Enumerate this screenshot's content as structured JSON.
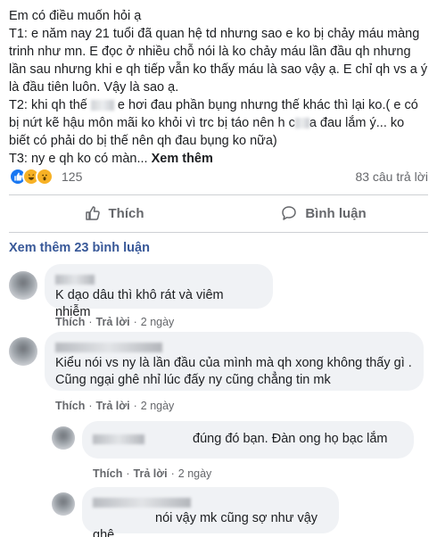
{
  "post": {
    "line1": "Em có điều muốn hỏi ạ",
    "t1": "T1: e năm nay 21 tuổi đã quan hệ td nhưng sao e ko bị chảy máu màng trinh như mn. E đọc ở nhiều chỗ nói là ko chảy máu lần đầu qh nhưng lần sau nhưng khi e qh tiếp vẫn ko thấy máu là sao vậy ạ. E chỉ qh vs a ý là đầu tiên luôn. Vậy là sao ạ.",
    "t2_a": "T2: khi qh thế",
    "t2_b": "e hơi đau phần bụng nhưng thế khác thì lại ko.( e có bị nứt kẽ hậu môn mãi ko khỏi vì trc bị táo nên h c",
    "t2_c": "a đau lắm ý... ko biết có phải do bị thế nên qh đau bụng ko nữa)",
    "t3": "T3: ny e qh ko có màn...",
    "see_more": "Xem thêm"
  },
  "reactions": {
    "count": "125",
    "answers": "83 câu trả lời"
  },
  "actions": {
    "like": "Thích",
    "comment": "Bình luận"
  },
  "view_more_comments": "Xem thêm 23 bình luận",
  "comments": [
    {
      "text": "K dạo dâu thì khô rát và viêm nhiễm",
      "like": "Thích",
      "reply": "Trả lời",
      "time": "2 ngày"
    },
    {
      "text": "Kiểu nói vs ny là lần đầu của mình mà qh xong không thấy gì . Cũng ngại ghê nhỉ lúc đấy ny cũng chẳng tin mk",
      "like": "Thích",
      "reply": "Trả lời",
      "time": "2 ngày"
    },
    {
      "text": "đúng đó bạn. Đàn ong họ bạc lắm",
      "like": "Thích",
      "reply": "Trả lời",
      "time": "2 ngày"
    },
    {
      "text": "nói vậy mk cũng sợ như vậy ghê"
    }
  ],
  "colors": {
    "link": "#385898",
    "bubble": "#f0f2f5",
    "muted": "#65676b",
    "like_blue": "#1877f2"
  }
}
